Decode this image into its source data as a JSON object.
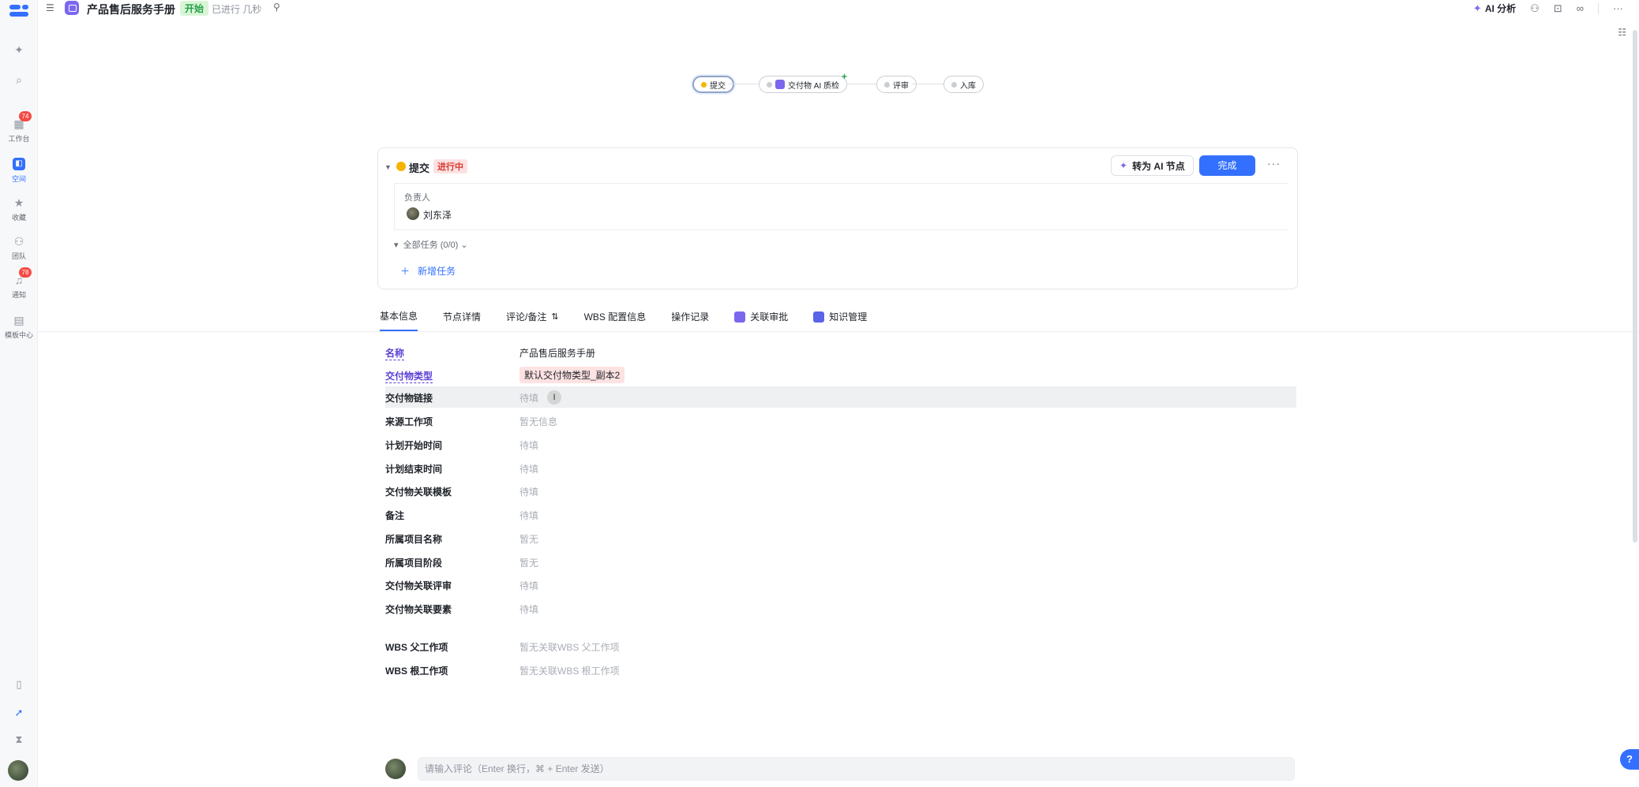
{
  "rail": {
    "items": [
      {
        "label": "",
        "icon": "sparkle-icon"
      },
      {
        "label": "",
        "icon": "search-icon"
      },
      {
        "label": "工作台",
        "icon": "workbench-icon",
        "badge": "74"
      },
      {
        "label": "空间",
        "icon": "space-icon"
      },
      {
        "label": "收藏",
        "icon": "star-icon"
      },
      {
        "label": "团队",
        "icon": "team-icon"
      },
      {
        "label": "通知",
        "icon": "bell-icon",
        "badge": "78"
      },
      {
        "label": "模板中心",
        "icon": "template-icon"
      }
    ]
  },
  "header": {
    "title": "产品售后服务手册",
    "status": "开始",
    "meta": "已进行 几秒",
    "ai_analysis": "AI 分析"
  },
  "flow": {
    "nodes": [
      "提交",
      "交付物 AI 质检",
      "评审",
      "入库"
    ]
  },
  "card": {
    "title": "提交",
    "status": "进行中",
    "ai_button": "转为 AI 节点",
    "done_button": "完成",
    "owner_label": "负责人",
    "owner_name": "刘东泽",
    "tasks_toggle": "全部任务 (0/0)",
    "add_task": "新增任务"
  },
  "tabs": [
    "基本信息",
    "节点详情",
    "评论/备注",
    "WBS 配置信息",
    "操作记录",
    "关联审批",
    "知识管理"
  ],
  "fields": [
    {
      "label": "名称",
      "value": "产品售后服务手册"
    },
    {
      "label": "交付物类型",
      "value": "默认交付物类型_副本2"
    },
    {
      "label": "交付物链接",
      "value": "待填"
    },
    {
      "label": "来源工作项",
      "value": "暂无信息"
    },
    {
      "label": "计划开始时间",
      "value": "待填"
    },
    {
      "label": "计划结束时间",
      "value": "待填"
    },
    {
      "label": "交付物关联模板",
      "value": "待填"
    },
    {
      "label": "备注",
      "value": "待填"
    },
    {
      "label": "所属项目名称",
      "value": "暂无"
    },
    {
      "label": "所属项目阶段",
      "value": "暂无"
    },
    {
      "label": "交付物关联评审",
      "value": "待填"
    },
    {
      "label": "交付物关联要素",
      "value": "待填"
    },
    {
      "label": "WBS 父工作项",
      "value": "暂无关联WBS 父工作项"
    },
    {
      "label": "WBS 根工作项",
      "value": "暂无关联WBS 根工作项"
    }
  ],
  "comment": {
    "placeholder": "请输入评论（Enter 换行，⌘ + Enter 发送）"
  },
  "colors": {
    "accent": "#3370ff",
    "ai_purple": "#7b67ee",
    "status_green": "#24a149",
    "status_red": "#d83931"
  }
}
